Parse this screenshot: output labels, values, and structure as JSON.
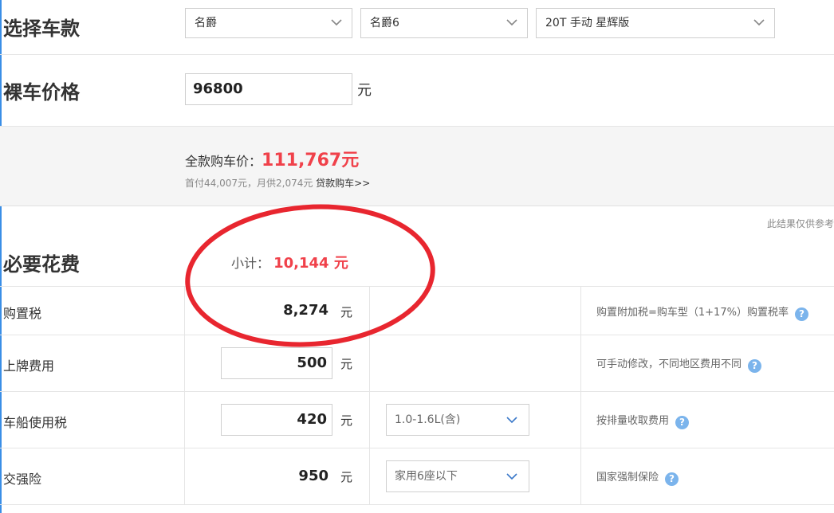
{
  "select_car": {
    "title": "选择车款",
    "brand": "名爵",
    "series": "名爵6",
    "model": "20T 手动 星辉版"
  },
  "bare_price": {
    "title": "裸车价格",
    "value": "96800",
    "unit": "元"
  },
  "total": {
    "label": "全款购车价：",
    "value": "111,767元",
    "sub": "首付44,007元，月供2,074元",
    "loan_link": "贷款购车>>"
  },
  "ref_note": "此结果仅供参考",
  "required": {
    "title": "必要花费",
    "subtotal_label": "小计：",
    "subtotal_value": "10,144 元"
  },
  "rows": [
    {
      "label": "购置税",
      "value": "8,274",
      "unit": "元",
      "note": "购置附加税=购车型（1+17%）购置税率"
    },
    {
      "label": "上牌费用",
      "value": "500",
      "unit": "元",
      "note": "可手动修改，不同地区费用不同"
    },
    {
      "label": "车船使用税",
      "value": "420",
      "unit": "元",
      "option": "1.0-1.6L(含)",
      "note": "按排量收取费用"
    },
    {
      "label": "交强险",
      "value": "950",
      "unit": "元",
      "option": "家用6座以下",
      "note": "国家强制保险"
    }
  ],
  "help_glyph": "?",
  "colors": {
    "accent_red": "#f0414a",
    "highlight_circle": "#e8262f",
    "help_icon": "#7bb4ec"
  }
}
